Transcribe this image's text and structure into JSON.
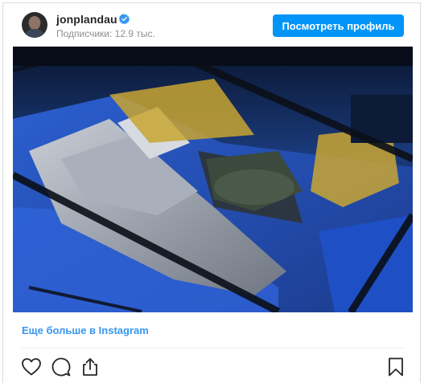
{
  "post": {
    "username": "jonplandau",
    "followers_text": "Подписчики: 12.9 тыс.",
    "view_profile_label": "Посмотреть профиль",
    "more_link_label": "Еще больше в Instagram"
  },
  "icons": {
    "verified": "verified-badge-icon",
    "like": "heart-icon",
    "comment": "comment-icon",
    "share": "share-icon",
    "save": "bookmark-icon"
  },
  "colors": {
    "accent": "#0095f6",
    "link": "#3897f0",
    "muted_text": "#8e8e8e",
    "border": "#dbdbdb"
  }
}
